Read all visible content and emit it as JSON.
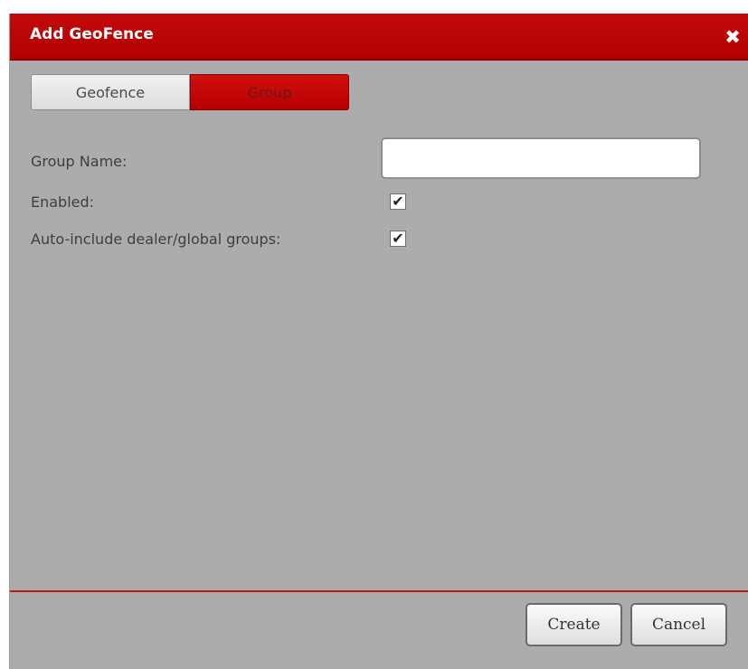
{
  "dialog": {
    "title": "Add GeoFence",
    "close_icon": "close-icon",
    "close_symbol": "✖"
  },
  "tabs": [
    {
      "label": "Geofence",
      "active": false
    },
    {
      "label": "Group",
      "active": true
    }
  ],
  "form": {
    "group_name_label": "Group Name:",
    "group_name_value": "",
    "enabled_label": "Enabled:",
    "enabled_checked": true,
    "auto_include_label": "Auto-include dealer/global groups:",
    "auto_include_checked": true,
    "check_symbol": "✔"
  },
  "footer": {
    "create_label": "Create",
    "cancel_label": "Cancel"
  },
  "colors": {
    "accent": "#b20000",
    "dialog_bg": "#acacac"
  }
}
